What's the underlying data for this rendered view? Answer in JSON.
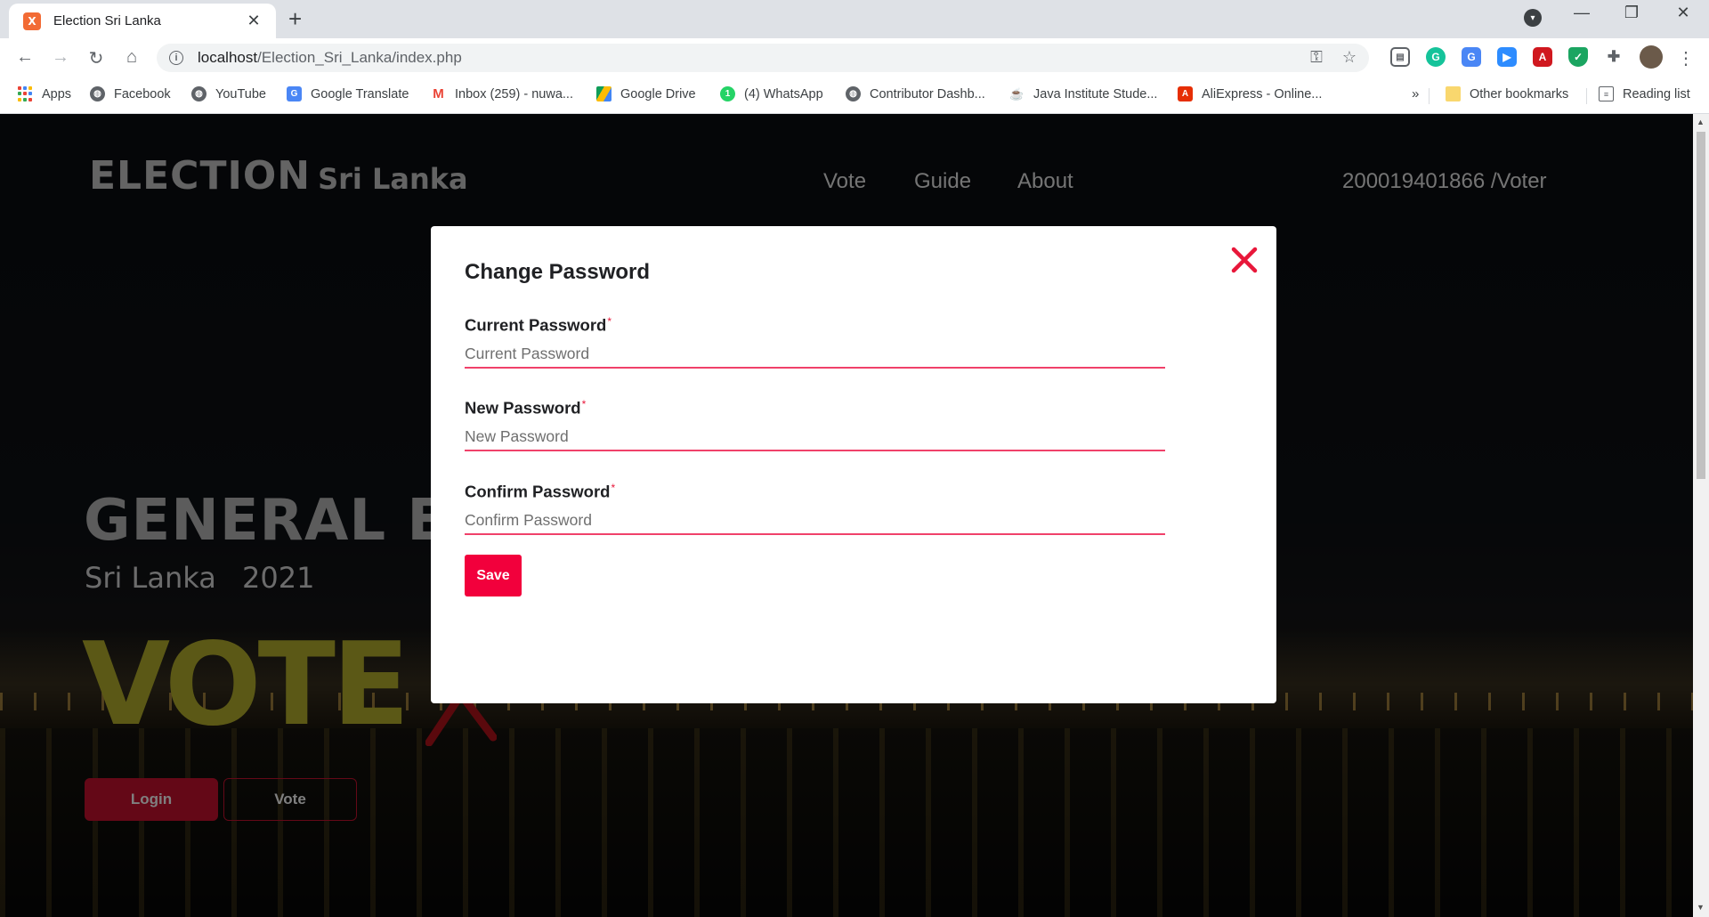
{
  "browser": {
    "tab_title": "Election Sri Lanka",
    "tab_favicon": "X",
    "url_host": "localhost",
    "url_path": "/Election_Sri_Lanka/index.php",
    "bookmarks": [
      {
        "label": "Apps",
        "icon": "apps-grid-icon"
      },
      {
        "label": "Facebook",
        "icon": "globe-icon"
      },
      {
        "label": "YouTube",
        "icon": "globe-icon"
      },
      {
        "label": "Google Translate",
        "icon": "translate-icon"
      },
      {
        "label": "Inbox (259) - nuwa...",
        "icon": "gmail-icon"
      },
      {
        "label": "Google Drive",
        "icon": "drive-icon"
      },
      {
        "label": "(4) WhatsApp",
        "icon": "whatsapp-icon"
      },
      {
        "label": "Contributor Dashb...",
        "icon": "globe-icon"
      },
      {
        "label": "Java Institute Stude...",
        "icon": "java-institute-icon"
      },
      {
        "label": "AliExpress - Online...",
        "icon": "aliexpress-icon"
      }
    ],
    "bookmarks_overflow": "»",
    "other_bookmarks": "Other bookmarks",
    "reading_list": "Reading list"
  },
  "site": {
    "brand_main": "ELECTION",
    "brand_sub": "Sri Lanka",
    "nav": [
      "Vote",
      "Guide",
      "About"
    ],
    "user_label": "200019401866 /Voter",
    "hero_title": "GENERAL ELECTION",
    "hero_country": "Sri Lanka",
    "hero_year": "2021",
    "hero_vote": "VOTE",
    "login_label": "Login",
    "vote_label": "Vote"
  },
  "modal": {
    "title": "Change Password",
    "required_mark": "*",
    "fields": [
      {
        "label": "Current Password",
        "placeholder": "Current Password"
      },
      {
        "label": "New Password",
        "placeholder": "New Password"
      },
      {
        "label": "Confirm Password",
        "placeholder": "Confirm Password"
      }
    ],
    "save_label": "Save"
  },
  "colors": {
    "accent": "#f2003c",
    "underline": "#f0416a",
    "close_x": "#e8173a",
    "vote_yellow": "#b7b12c"
  }
}
